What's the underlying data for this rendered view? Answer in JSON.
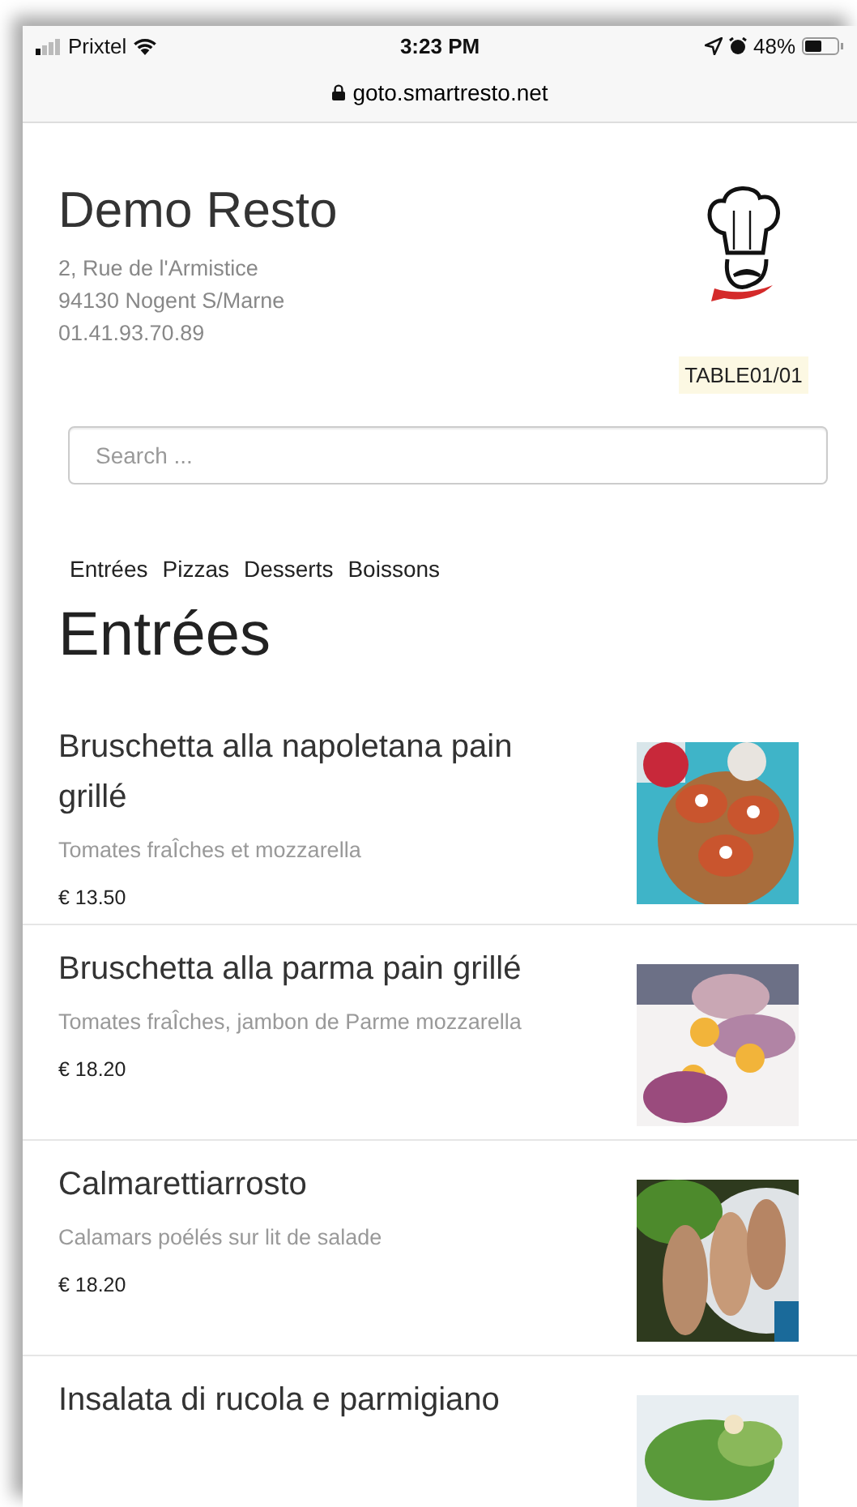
{
  "status_bar": {
    "carrier": "Prixtel",
    "time": "3:23 PM",
    "battery": "48%"
  },
  "address_bar": {
    "url": "goto.smartresto.net"
  },
  "restaurant": {
    "name": "Demo Resto",
    "address_lines": [
      "2, Rue de l'Armistice",
      "94130 Nogent S/Marne",
      "01.41.93.70.89"
    ],
    "table": "TABLE01/01"
  },
  "search": {
    "placeholder": "Search ..."
  },
  "categories": [
    "Entrées",
    "Pizzas",
    "Desserts",
    "Boissons"
  ],
  "section": {
    "title": "Entrées",
    "items": [
      {
        "name": "Bruschetta alla napoletana pain grillé",
        "description": "Tomates fraÎches et mozzarella",
        "price": "€ 13.50"
      },
      {
        "name": "Bruschetta alla parma pain grillé",
        "description": "Tomates fraÎches, jambon de Parme mozzarella",
        "price": "€ 18.20"
      },
      {
        "name": "Calmarettiarrosto",
        "description": "Calamars poélés sur lit de salade",
        "price": "€ 18.20"
      },
      {
        "name": "Insalata di rucola e parmigiano"
      }
    ]
  }
}
